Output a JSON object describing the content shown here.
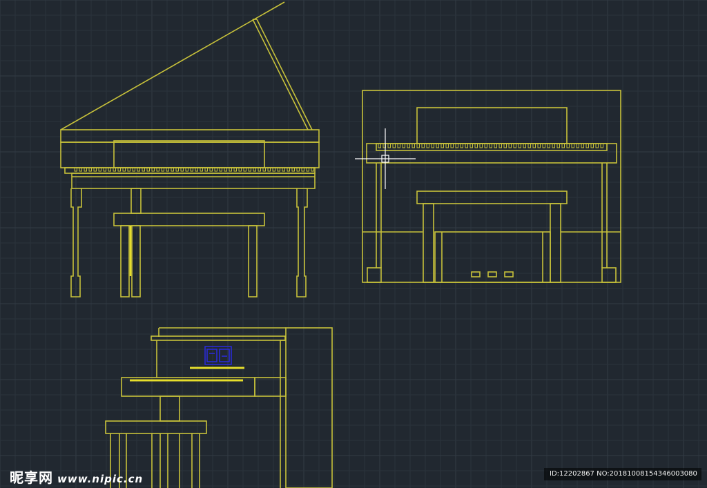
{
  "colors": {
    "background": "#212830",
    "grid_minor": "#2b333c",
    "grid_major": "#323b45",
    "drawing": "#c8c23a",
    "highlight": "#e6de2c",
    "crosshair": "#ffffff",
    "blue_mark": "#2a2ae0"
  },
  "icons": {
    "crosshair": "crosshair-cursor-icon"
  },
  "watermark": {
    "brand": "昵享网",
    "site": "www.nipic.cn"
  },
  "id_bar": {
    "text": "ID:12202867 NO:20181008154346003080"
  }
}
